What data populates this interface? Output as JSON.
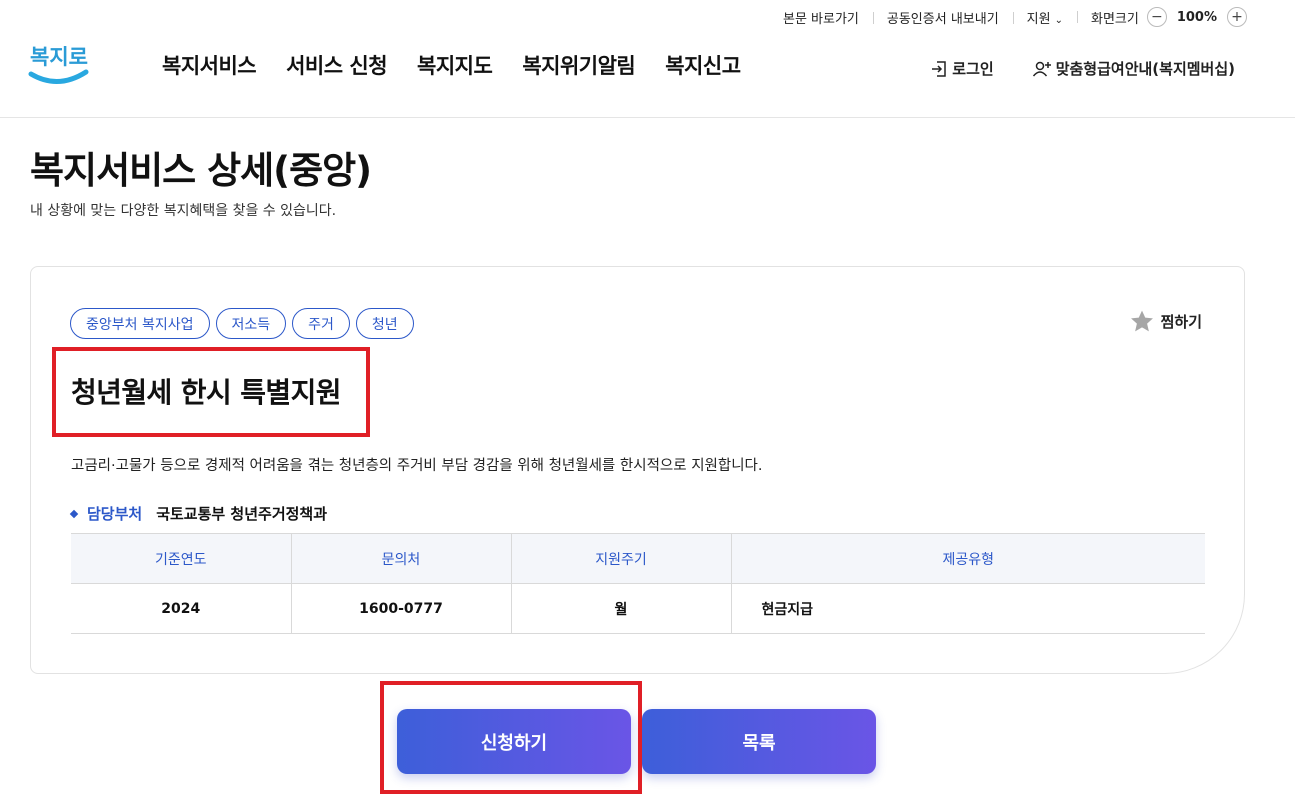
{
  "util_bar": {
    "skip_to_content": "본문 바로가기",
    "cert_export": "공동인증서 내보내기",
    "region": "지원",
    "zoom_label": "화면크기",
    "zoom_value": "100%"
  },
  "header": {
    "logo_text": "복지로",
    "nav": [
      "복지서비스",
      "서비스 신청",
      "복지지도",
      "복지위기알림",
      "복지신고"
    ],
    "login": "로그인",
    "membership": "맞춤형급여안내(복지멤버십)"
  },
  "page": {
    "title": "복지서비스 상세(중앙)",
    "description": "내 상황에 맞는 다양한 복지혜택을 찾을 수 있습니다."
  },
  "service": {
    "tags": [
      "중앙부처 복지사업",
      "저소득",
      "주거",
      "청년"
    ],
    "favorite_label": "찜하기",
    "title": "청년월세 한시 특별지원",
    "description": "고금리·고물가 등으로 경제적 어려움을 겪는 청년층의 주거비 부담 경감을 위해 청년월세를 한시적으로 지원합니다.",
    "dept_label": "담당부처",
    "dept_value": "국토교통부 청년주거정책과",
    "table": {
      "headers": [
        "기준연도",
        "문의처",
        "지원주기",
        "제공유형"
      ],
      "row": [
        "2024",
        "1600-0777",
        "월",
        "현금지급"
      ]
    }
  },
  "buttons": {
    "apply": "신청하기",
    "list": "목록"
  },
  "colors": {
    "accent": "#2c58c9",
    "button_gradient_start": "#3d5fd9",
    "button_gradient_end": "#6a55e6",
    "highlight": "#e01f26"
  }
}
